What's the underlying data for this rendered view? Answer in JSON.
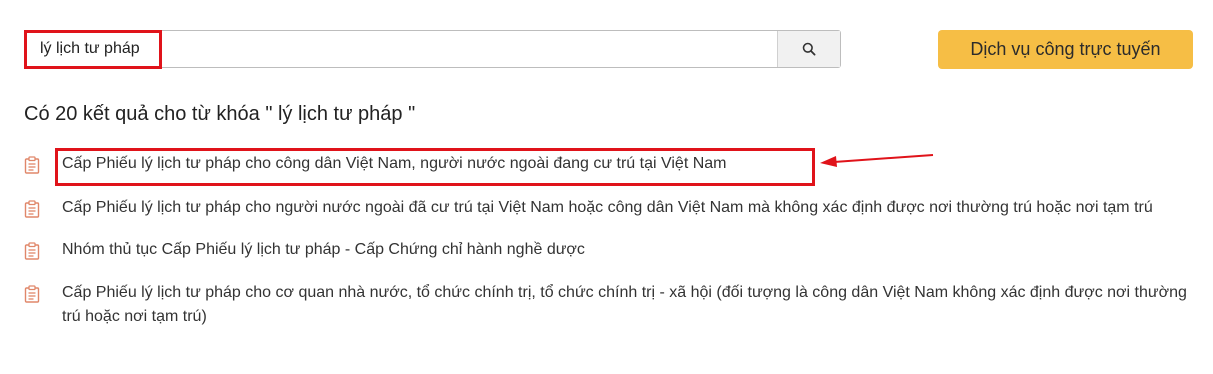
{
  "search": {
    "value": "lý lịch tư pháp",
    "placeholder": "",
    "button_icon": "search-icon"
  },
  "header": {
    "service_button_label": "Dịch vụ công trực tuyến"
  },
  "results": {
    "heading": "Có 20 kết quả cho từ khóa \" lý lịch tư pháp \"",
    "icon": "document-icon",
    "icon_color": "#e0876a",
    "items": [
      {
        "label": "Cấp Phiếu lý lịch tư pháp cho công dân Việt Nam, người nước ngoài đang cư trú tại Việt Nam"
      },
      {
        "label": "Cấp Phiếu lý lịch tư pháp cho người nước ngoài đã cư trú tại Việt Nam hoặc công dân Việt Nam mà không xác định được nơi thường trú hoặc nơi tạm trú"
      },
      {
        "label": "Nhóm thủ tục Cấp Phiếu lý lịch tư pháp - Cấp Chứng chỉ hành nghề dược"
      },
      {
        "label": "Cấp Phiếu lý lịch tư pháp cho cơ quan nhà nước, tổ chức chính trị, tổ chức chính trị - xã hội (đối tượng là công dân Việt Nam không xác định được nơi thường trú hoặc nơi tạm trú)"
      }
    ]
  },
  "annotation": {
    "color": "#e0131a"
  }
}
